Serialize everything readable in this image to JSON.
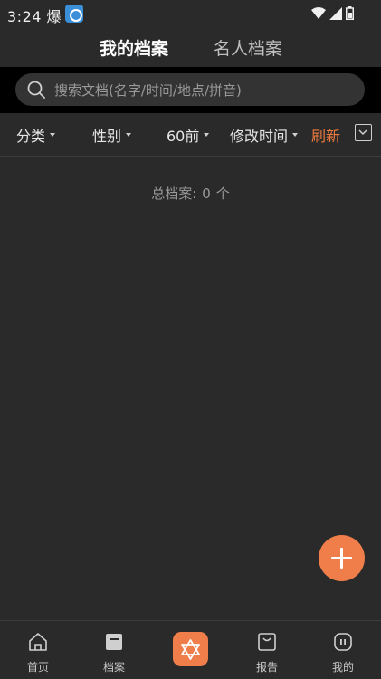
{
  "status_bar": {
    "time": "3:24 爆"
  },
  "header": {
    "tab_mine": "我的档案",
    "tab_celeb": "名人档案"
  },
  "search": {
    "placeholder": "搜索文档(名字/时间/地点/拼音)"
  },
  "filters": {
    "category": "分类",
    "gender": "性别",
    "age": "60前",
    "sort": "修改时间",
    "refresh": "刷新"
  },
  "summary": {
    "label": "总档案:",
    "count": "0",
    "unit": "个"
  },
  "bottom_nav": {
    "home": "首页",
    "archive": "档案",
    "report": "报告",
    "mine": "我的"
  },
  "colors": {
    "accent": "#f07b3f",
    "background": "#2a2a2a",
    "search_band": "#000000"
  }
}
